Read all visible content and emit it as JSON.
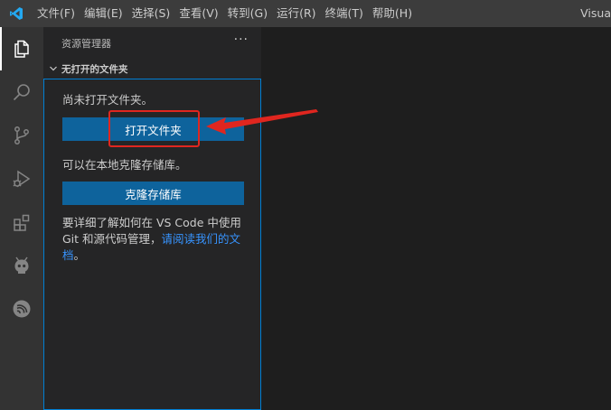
{
  "window_title": "Visua",
  "menu": [
    "文件(F)",
    "编辑(E)",
    "选择(S)",
    "查看(V)",
    "转到(G)",
    "运行(R)",
    "终端(T)",
    "帮助(H)"
  ],
  "activity_icons": [
    "explorer-icon",
    "search-icon",
    "source-control-icon",
    "run-debug-icon",
    "extensions-icon",
    "platformio-icon",
    "esp-idf-icon"
  ],
  "sidebar": {
    "title": "资源管理器",
    "more": "···",
    "section_title": "无打开的文件夹",
    "no_folder_text": "尚未打开文件夹。",
    "open_folder_button": "打开文件夹",
    "clone_text": "可以在本地克隆存储库。",
    "clone_button": "克隆存储库",
    "git_text": "要详细了解如何在 VS Code 中使用 Git 和源代码管理，",
    "git_link": "请阅读我们的文档",
    "git_end": "。"
  },
  "colors": {
    "titlebar": "#3c3c3c",
    "activitybar": "#333333",
    "sidebar": "#252526",
    "editor": "#1e1e1e",
    "button": "#0e639c",
    "link": "#3794ff",
    "focus_border": "#007fd4",
    "annotation": "#e0261f"
  }
}
